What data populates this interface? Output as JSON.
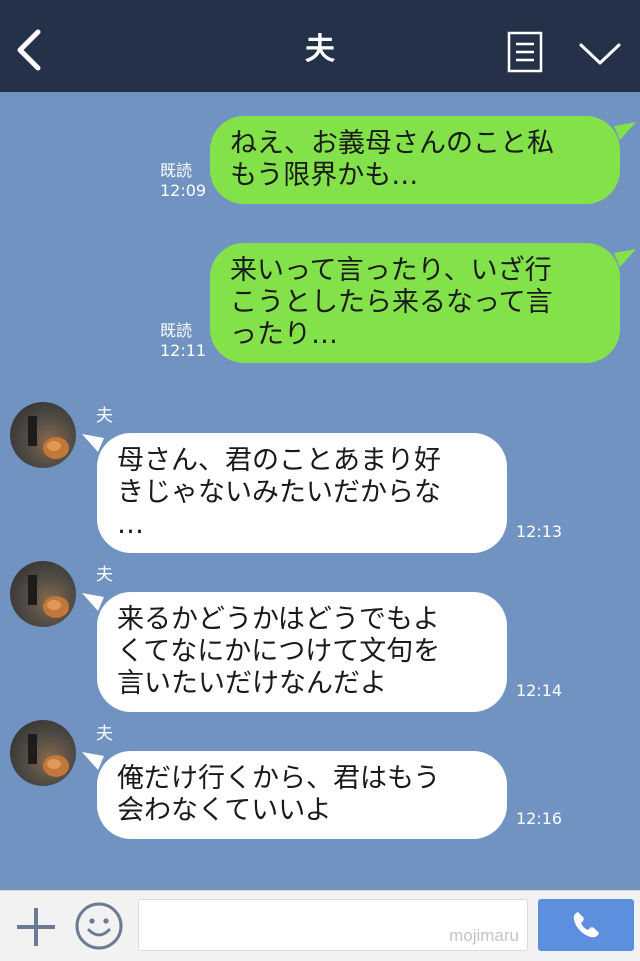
{
  "header": {
    "title": "夫"
  },
  "messages": [
    {
      "side": "out",
      "lines": "ねえ、お義母さんのこと私\nもう限界かも…",
      "read": "既読",
      "time": "12:09"
    },
    {
      "side": "out",
      "lines": "来いって言ったり、いざ行\nこうとしたら来るなって言\nったり…",
      "read": "既読",
      "time": "12:11"
    },
    {
      "side": "in",
      "sender": "夫",
      "lines": "母さん、君のことあまり好\nきじゃないみたいだからな\n…",
      "time": "12:13"
    },
    {
      "side": "in",
      "sender": "夫",
      "lines": "来るかどうかはどうでもよ\nくてなにかにつけて文句を\n言いたいだけなんだよ",
      "time": "12:14"
    },
    {
      "side": "in",
      "sender": "夫",
      "lines": "俺だけ行くから、君はもう\n会わなくていいよ",
      "time": "12:16"
    }
  ],
  "footer": {
    "input_value": "",
    "watermark": "mojimaru"
  },
  "icons": {
    "back": "back-chevron-icon",
    "notes": "notes-icon",
    "menu": "chevron-down-icon",
    "plus": "plus-icon",
    "emoji": "emoji-icon",
    "call": "phone-icon"
  },
  "colors": {
    "header_bg": "#253148",
    "chat_bg": "#7193c2",
    "outgoing_bubble": "#83e24a",
    "incoming_bubble": "#ffffff",
    "call_button": "#5d8fdf"
  }
}
